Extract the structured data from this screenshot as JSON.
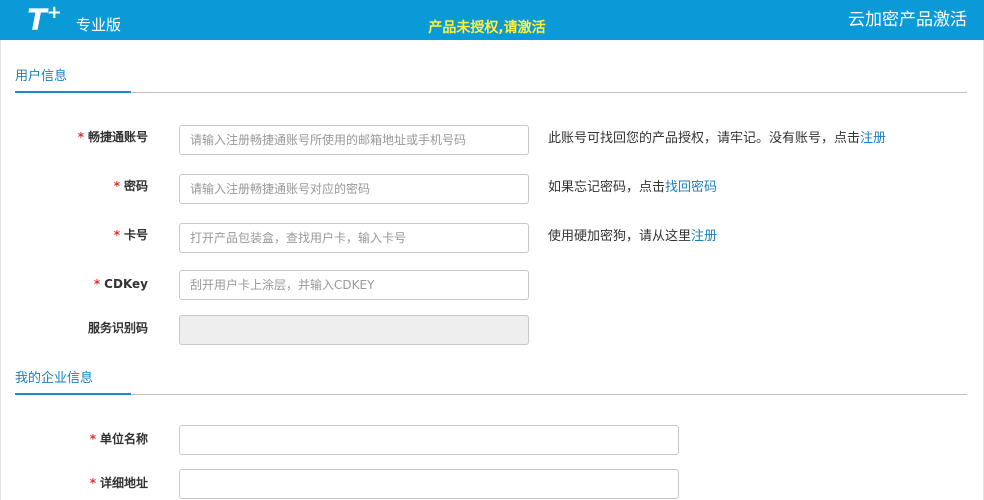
{
  "header": {
    "logo_letter": "T",
    "logo_plus": "+",
    "edition": "专业版",
    "notice": "产品未授权,请激活",
    "title": "云加密产品激活"
  },
  "sections": {
    "user_info": "用户信息",
    "company_info": "我的企业信息"
  },
  "required_mark": "*",
  "user_fields": {
    "account": {
      "label": "畅捷通账号",
      "placeholder": "请输入注册畅捷通账号所使用的邮箱地址或手机号码",
      "hint": "此账号可找回您的产品授权，请牢记。没有账号，点击",
      "hint_link": "注册"
    },
    "password": {
      "label": "密码",
      "placeholder": "请输入注册畅捷通账号对应的密码",
      "hint": "如果忘记密码，点击",
      "hint_link": "找回密码"
    },
    "card": {
      "label": "卡号",
      "placeholder": "打开产品包装盒，查找用户卡，输入卡号",
      "hint": "使用硬加密狗，请从这里",
      "hint_link": "注册"
    },
    "cdkey": {
      "label": "CDKey",
      "placeholder": "刮开用户卡上涂层，并输入CDKEY"
    },
    "service_code": {
      "label": "服务识别码",
      "value": ""
    }
  },
  "company_fields": {
    "company_name": {
      "label": "单位名称",
      "value": ""
    },
    "address": {
      "label": "详细地址",
      "value": ""
    }
  }
}
